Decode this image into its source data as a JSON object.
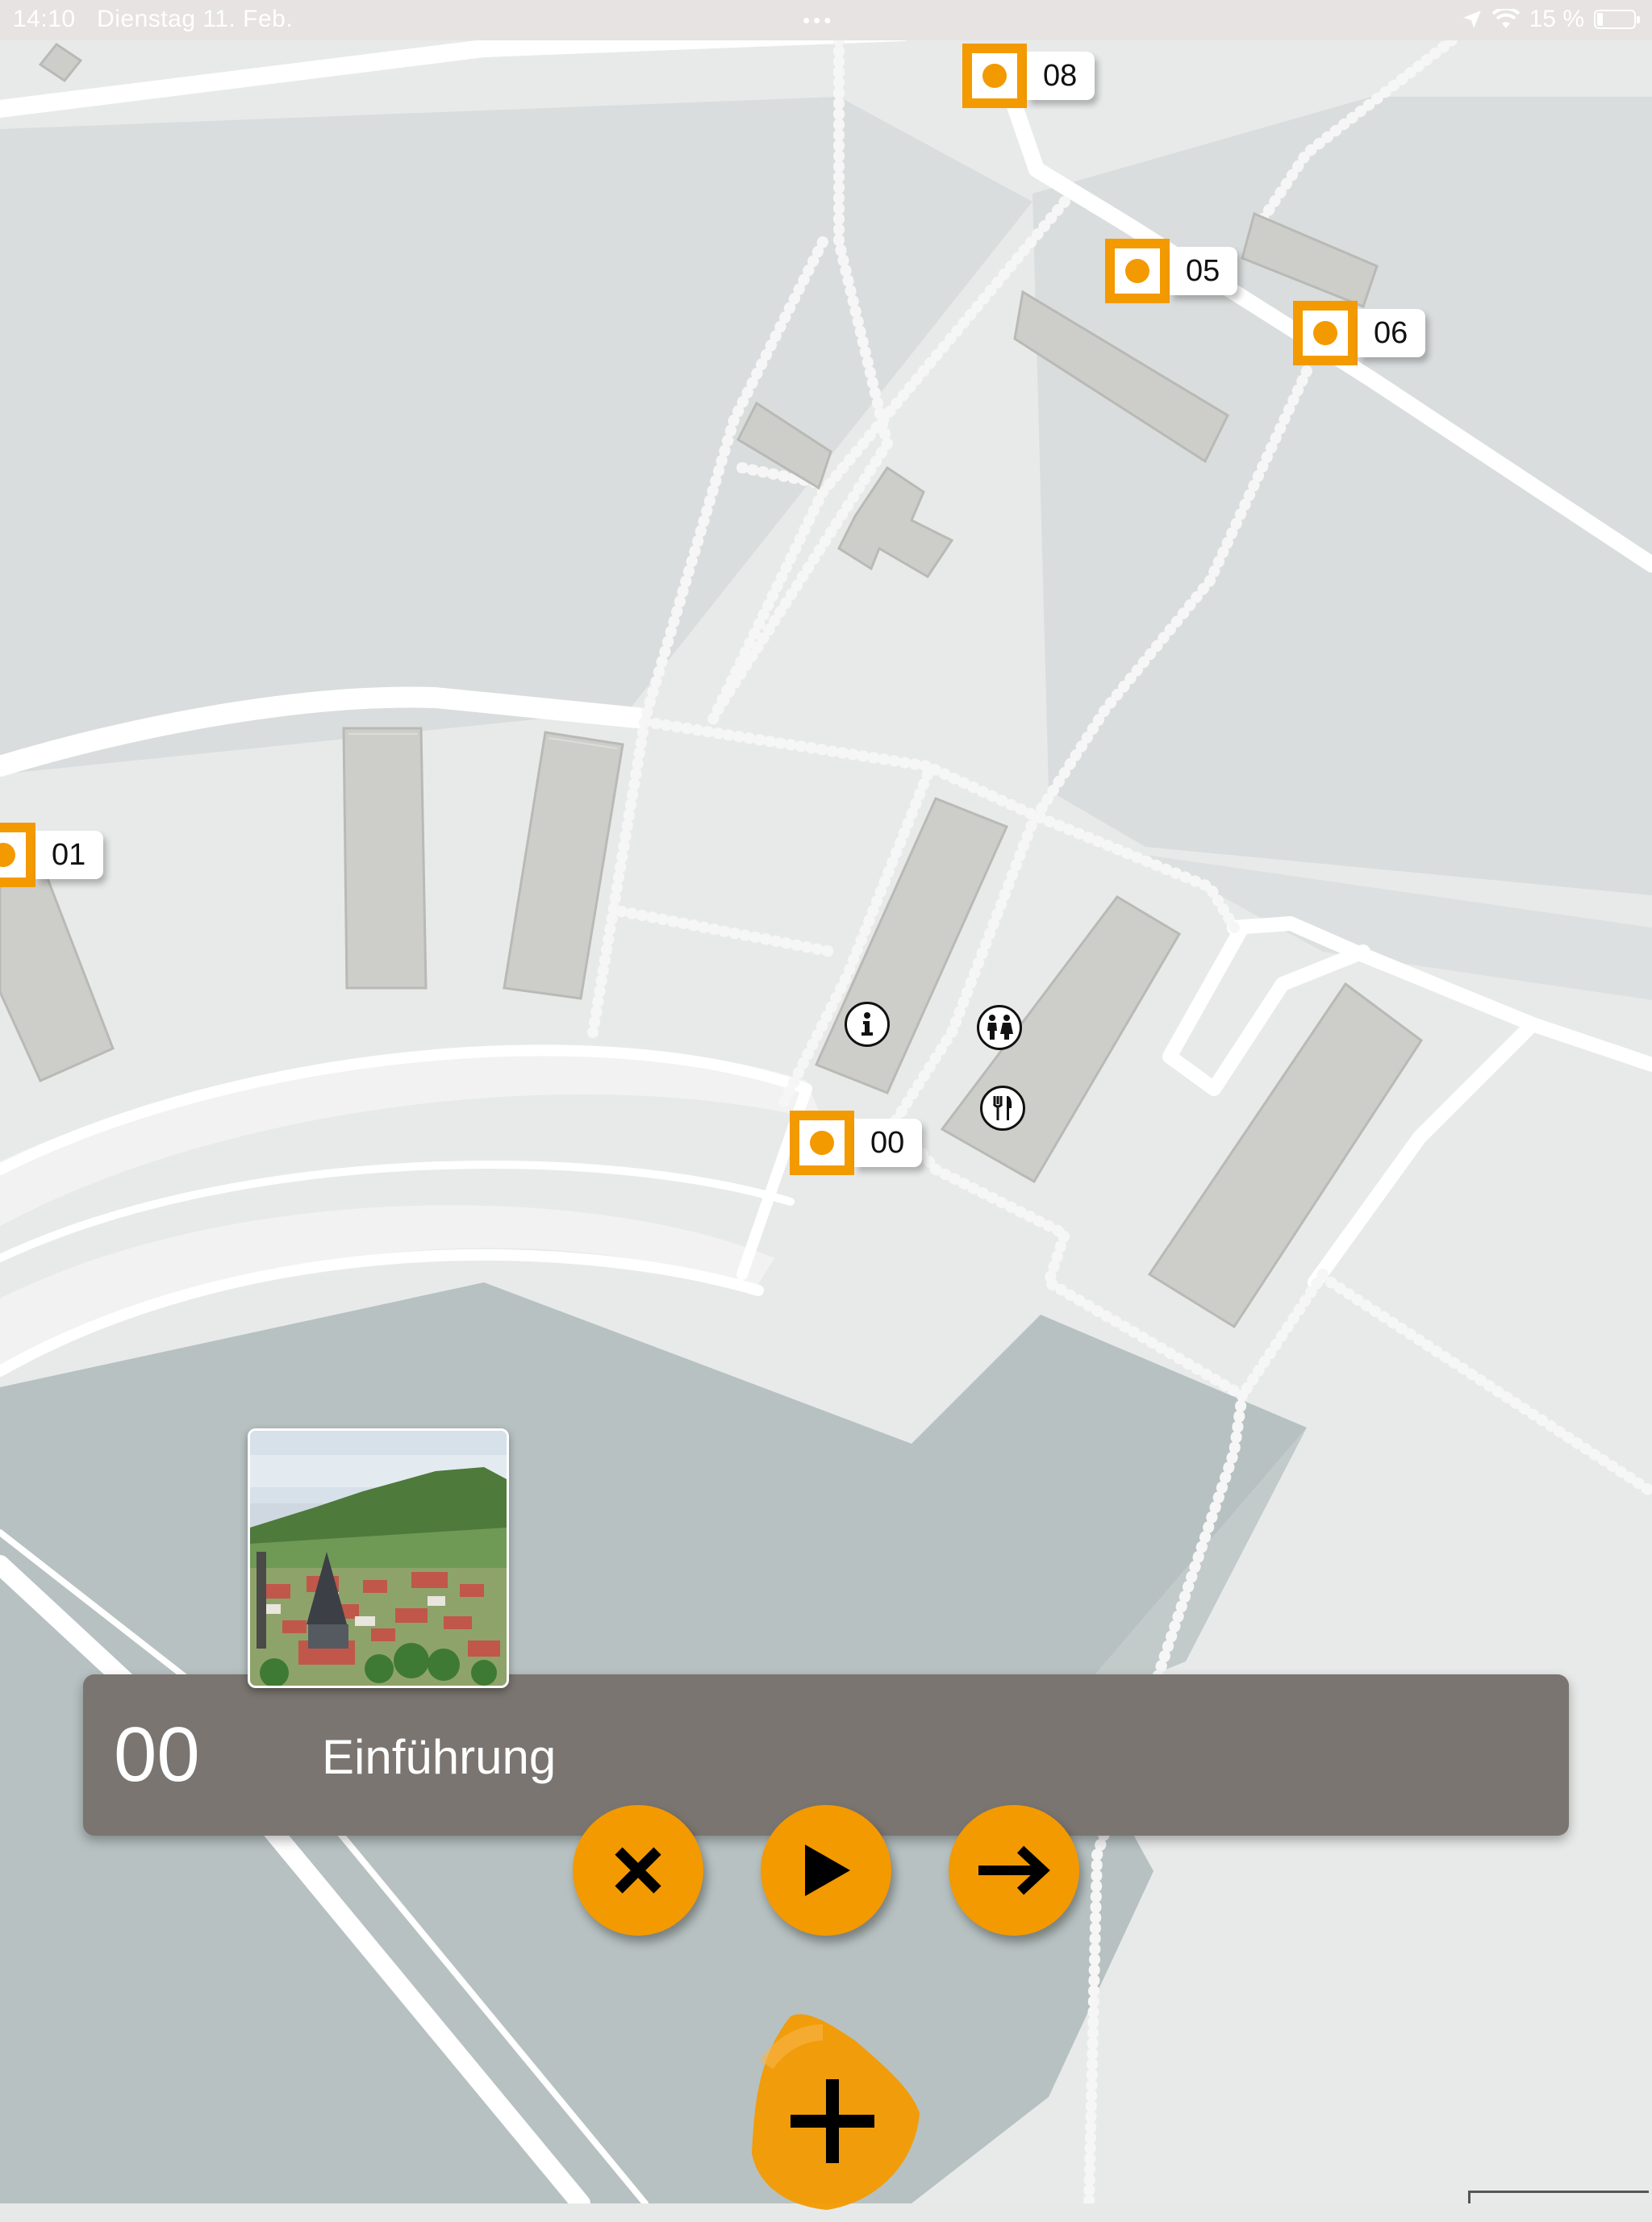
{
  "status_bar": {
    "time": "14:10",
    "date": "Dienstag 11. Feb.",
    "battery_percent": "15 %",
    "battery_level": 0.15,
    "icons": [
      "location-arrow-icon",
      "wifi-icon",
      "battery-icon"
    ]
  },
  "map": {
    "stations": [
      {
        "number": "08"
      },
      {
        "number": "05"
      },
      {
        "number": "06"
      },
      {
        "number": "01"
      },
      {
        "number": "00"
      }
    ],
    "poi_icons": [
      "info-icon",
      "restroom-icon",
      "restaurant-icon"
    ]
  },
  "info_panel": {
    "number": "00",
    "title": "Einführung"
  },
  "controls": {
    "close": "close-icon",
    "play": "play-icon",
    "next": "arrow-right-icon",
    "add": "plus-icon"
  },
  "colors": {
    "accent": "#f39a00",
    "panel": "#7a7570",
    "building": "#cdcdca",
    "road": "#ffffff",
    "water": "#b7c1c1"
  }
}
